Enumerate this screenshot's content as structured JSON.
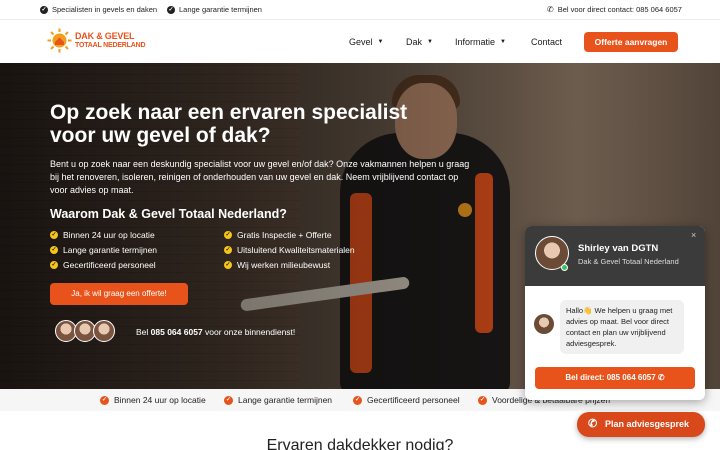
{
  "topbar": {
    "left_items": [
      "Specialisten in gevels en daken",
      "Lange garantie termijnen"
    ],
    "phone": "Bel voor direct contact: 085 064 6057"
  },
  "nav": {
    "logo_line1": "DAK & GEVEL",
    "logo_line2": "TOTAAL NEDERLAND",
    "menu": [
      "Gevel",
      "Dak",
      "Informatie",
      "Contact"
    ],
    "cta": "Offerte aanvragen"
  },
  "hero": {
    "title": "Op zoek naar een ervaren specialist voor uw gevel of dak?",
    "description": "Bent u op zoek naar een deskundig specialist voor uw gevel en/of dak? Onze vakmannen helpen u graag bij het renoveren, isoleren, reinigen of onderhouden van uw gevel en dak. Neem vrijblijvend contact op voor advies op maat.",
    "why_title": "Waarom Dak & Gevel Totaal Nederland?",
    "bullets": [
      "Binnen 24 uur op locatie",
      "Gratis Inspectie + Offerte",
      "Lange garantie termijnen",
      "Uitsluitend Kwaliteitsmaterialen",
      "Gecertificeerd personeel",
      "Wij werken milieubewust"
    ],
    "cta": "Ja, ik wil graag een offerte!",
    "call_prefix": "Bel ",
    "call_number": "085 064 6057",
    "call_suffix": " voor onze binnendienst!"
  },
  "strip": {
    "items": [
      "Binnen 24 uur op locatie",
      "Lange garantie termijnen",
      "Gecertificeerd personeel",
      "Voordelige & betaalbare prijzen"
    ]
  },
  "section": {
    "title": "Ervaren dakdekker nodig?"
  },
  "chat": {
    "name": "Shirley van DGTN",
    "company": "Dak & Gevel Totaal Nederland",
    "close": "×",
    "message": "Hallo👋 We helpen u graag met advies op maat. Bel voor direct contact en plan uw vrijblijvend adviesgesprek.",
    "call_button": "Bel direct: 085 064 6057"
  },
  "float_button": "Plan adviesgesprek",
  "colors": {
    "accent": "#e8531c",
    "check_yellow": "#f5c518",
    "chat_header": "#3b3b3b"
  }
}
